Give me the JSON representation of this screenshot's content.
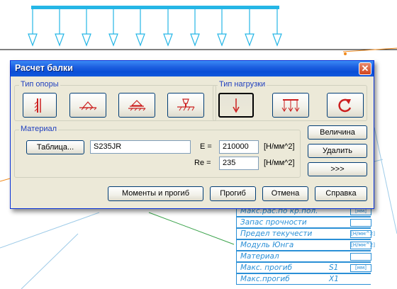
{
  "dialog": {
    "title": "Расчет балки",
    "close_glyph": "✕",
    "support_group": {
      "label": "Тип опоры"
    },
    "load_group": {
      "label": "Тип нагрузки"
    },
    "material_group": {
      "label": "Материал",
      "table_button": "Таблица...",
      "material_value": "S235JR",
      "e_label": "E =",
      "e_value": "210000",
      "e_unit": "[Н/мм^2]",
      "re_label": "Re =",
      "re_value": "235",
      "re_unit": "[Н/мм^2]"
    },
    "side_buttons": {
      "magnitude": "Величина",
      "delete": "Удалить",
      "more": ">>>"
    },
    "bottom_buttons": {
      "moments": "Моменты и прогиб",
      "deflection": "Прогиб",
      "cancel": "Отмена",
      "help": "Справка"
    }
  },
  "background_table": {
    "rows": [
      {
        "label": "Макс.рас.по кр.пол.",
        "unit": "[мм]"
      },
      {
        "label": "Запас прочности",
        "unit": ""
      },
      {
        "label": "Предел текучести",
        "unit": "[Н/мм^2]"
      },
      {
        "label": "Модуль Юнга",
        "unit": "[Н/мм^2]"
      },
      {
        "label": "Материал",
        "unit": ""
      },
      {
        "label": "Макс. прогиб",
        "value": "S1",
        "unit": "[мм]"
      },
      {
        "label": "Макс.прогиб",
        "value": "X1",
        "unit": ""
      }
    ]
  },
  "colors": {
    "cad_line": "#2a8fd6",
    "load_arrow": "#25b6e6",
    "dialog_bg": "#ece9d8",
    "title_bar": "#0a4ed6",
    "icon_red": "#cc1f1f"
  }
}
